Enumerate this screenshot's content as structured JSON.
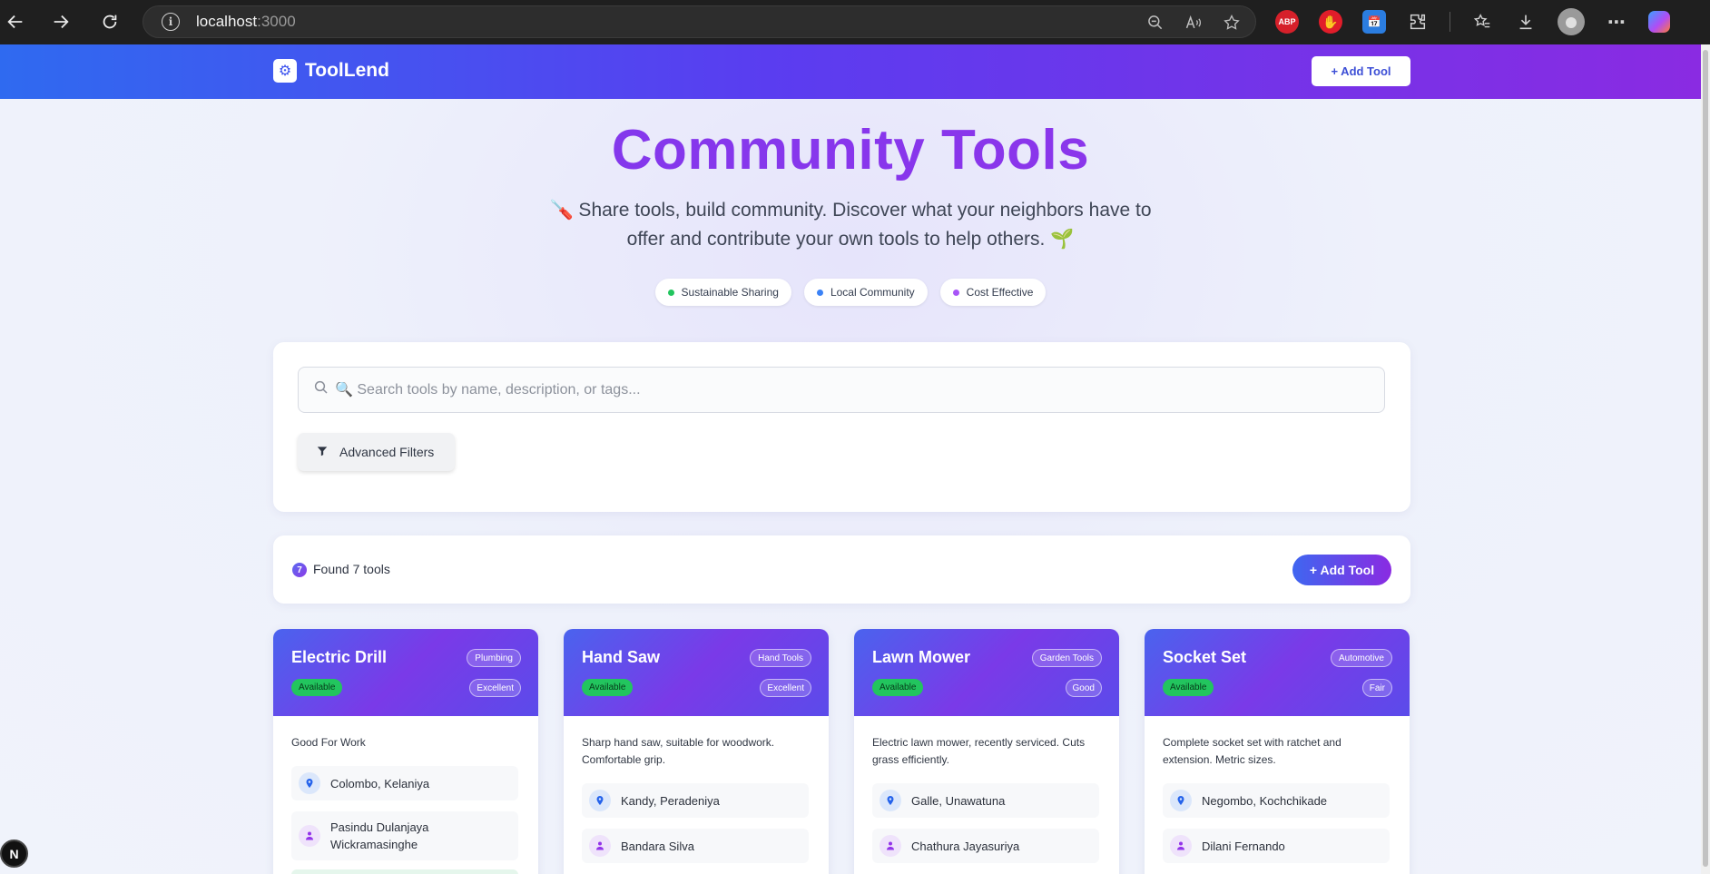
{
  "browser": {
    "url_host": "localhost",
    "url_port": ":3000",
    "extensions": [
      "ABP",
      "✋",
      "📅"
    ]
  },
  "header": {
    "logo_text": "ToolLend",
    "add_tool_label": "+ Add Tool"
  },
  "hero": {
    "title": "Community Tools",
    "subtitle": "🪛 Share tools, build community. Discover what your neighbors have to offer and contribute your own tools to help others. 🌱",
    "pills": [
      {
        "label": "Sustainable Sharing",
        "color": "#22c55e"
      },
      {
        "label": "Local Community",
        "color": "#3b82f6"
      },
      {
        "label": "Cost Effective",
        "color": "#a855f7"
      }
    ]
  },
  "search": {
    "placeholder": "🔍 Search tools by name, description, or tags...",
    "advanced_filters_label": "Advanced Filters"
  },
  "results": {
    "count": "7",
    "found_text": "Found 7 tools",
    "add_tool_label": "+ Add Tool"
  },
  "tools": [
    {
      "name": "Electric Drill",
      "category": "Plumbing",
      "availability": "Available",
      "condition": "Excellent",
      "description": "Good For Work",
      "location": "Colombo, Kelaniya",
      "owner": "Pasindu Dulanjaya Wickramasinghe"
    },
    {
      "name": "Hand Saw",
      "category": "Hand Tools",
      "availability": "Available",
      "condition": "Excellent",
      "description": "Sharp hand saw, suitable for woodwork. Comfortable grip.",
      "location": "Kandy, Peradeniya",
      "owner": "Bandara Silva"
    },
    {
      "name": "Lawn Mower",
      "category": "Garden Tools",
      "availability": "Available",
      "condition": "Good",
      "description": "Electric lawn mower, recently serviced. Cuts grass efficiently.",
      "location": "Galle, Unawatuna",
      "owner": "Chathura Jayasuriya"
    },
    {
      "name": "Socket Set",
      "category": "Automotive",
      "availability": "Available",
      "condition": "Fair",
      "description": "Complete socket set with ratchet and extension. Metric sizes.",
      "location": "Negombo, Kochchikade",
      "owner": "Dilani Fernando"
    }
  ],
  "dev_badge": "N"
}
